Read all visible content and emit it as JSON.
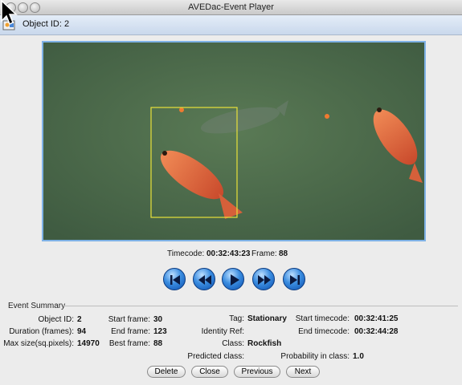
{
  "window": {
    "title": "AVEDac-Event Player"
  },
  "toolbar": {
    "object_label": "Object ID: 2"
  },
  "info": {
    "timecode_label": "Timecode:",
    "timecode_value": "00:32:43:23",
    "frame_label": "Frame:",
    "frame_value": "88"
  },
  "transport": [
    {
      "name": "skip-to-start",
      "icon": "skip-start-icon"
    },
    {
      "name": "rewind",
      "icon": "rewind-icon"
    },
    {
      "name": "play",
      "icon": "play-icon"
    },
    {
      "name": "fast-forward",
      "icon": "fast-forward-icon"
    },
    {
      "name": "skip-to-end",
      "icon": "skip-end-icon"
    }
  ],
  "summary": {
    "group_label": "Event Summary",
    "object_id_label": "Object ID:",
    "object_id_value": "2",
    "duration_label": "Duration (frames):",
    "duration_value": "94",
    "max_size_label": "Max size(sq.pixels):",
    "max_size_value": "14970",
    "start_frame_label": "Start frame:",
    "start_frame_value": "30",
    "end_frame_label": "End frame:",
    "end_frame_value": "123",
    "best_frame_label": "Best frame:",
    "best_frame_value": "88",
    "tag_label": "Tag:",
    "tag_value": "Stationary",
    "identity_ref_label": "Identity Ref:",
    "identity_ref_value": "",
    "class_label": "Class:",
    "class_value": "Rockfish",
    "predicted_class_label": "Predicted class:",
    "predicted_class_value": "",
    "start_timecode_label": "Start timecode:",
    "start_timecode_value": "00:32:41:25",
    "end_timecode_label": "End timecode:",
    "end_timecode_value": "00:32:44:28",
    "probability_label": "Probability in class:",
    "probability_value": "1.0"
  },
  "buttons": {
    "delete": "Delete",
    "close": "Close",
    "previous": "Previous",
    "next": "Next"
  },
  "colors": {
    "video_bg": "#4d6a4b",
    "bbox": "#e8e23a",
    "fish": "#e0673f",
    "accent": "#3b8de0"
  }
}
